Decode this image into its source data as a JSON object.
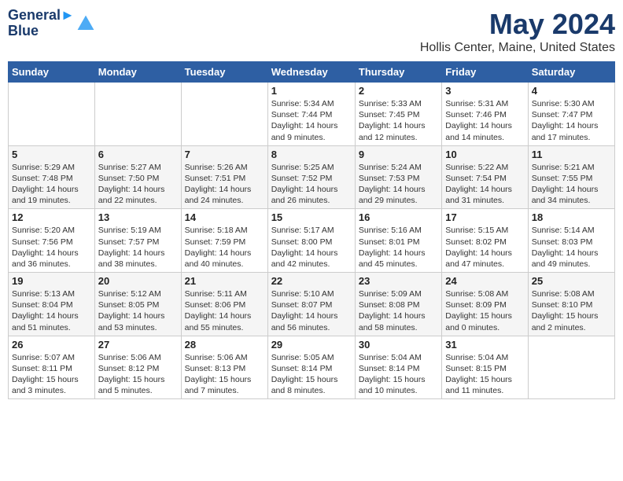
{
  "header": {
    "logo_line1": "General",
    "logo_line2": "Blue",
    "month": "May 2024",
    "location": "Hollis Center, Maine, United States"
  },
  "weekdays": [
    "Sunday",
    "Monday",
    "Tuesday",
    "Wednesday",
    "Thursday",
    "Friday",
    "Saturday"
  ],
  "weeks": [
    [
      {
        "day": "",
        "info": ""
      },
      {
        "day": "",
        "info": ""
      },
      {
        "day": "",
        "info": ""
      },
      {
        "day": "1",
        "info": "Sunrise: 5:34 AM\nSunset: 7:44 PM\nDaylight: 14 hours\nand 9 minutes."
      },
      {
        "day": "2",
        "info": "Sunrise: 5:33 AM\nSunset: 7:45 PM\nDaylight: 14 hours\nand 12 minutes."
      },
      {
        "day": "3",
        "info": "Sunrise: 5:31 AM\nSunset: 7:46 PM\nDaylight: 14 hours\nand 14 minutes."
      },
      {
        "day": "4",
        "info": "Sunrise: 5:30 AM\nSunset: 7:47 PM\nDaylight: 14 hours\nand 17 minutes."
      }
    ],
    [
      {
        "day": "5",
        "info": "Sunrise: 5:29 AM\nSunset: 7:48 PM\nDaylight: 14 hours\nand 19 minutes."
      },
      {
        "day": "6",
        "info": "Sunrise: 5:27 AM\nSunset: 7:50 PM\nDaylight: 14 hours\nand 22 minutes."
      },
      {
        "day": "7",
        "info": "Sunrise: 5:26 AM\nSunset: 7:51 PM\nDaylight: 14 hours\nand 24 minutes."
      },
      {
        "day": "8",
        "info": "Sunrise: 5:25 AM\nSunset: 7:52 PM\nDaylight: 14 hours\nand 26 minutes."
      },
      {
        "day": "9",
        "info": "Sunrise: 5:24 AM\nSunset: 7:53 PM\nDaylight: 14 hours\nand 29 minutes."
      },
      {
        "day": "10",
        "info": "Sunrise: 5:22 AM\nSunset: 7:54 PM\nDaylight: 14 hours\nand 31 minutes."
      },
      {
        "day": "11",
        "info": "Sunrise: 5:21 AM\nSunset: 7:55 PM\nDaylight: 14 hours\nand 34 minutes."
      }
    ],
    [
      {
        "day": "12",
        "info": "Sunrise: 5:20 AM\nSunset: 7:56 PM\nDaylight: 14 hours\nand 36 minutes."
      },
      {
        "day": "13",
        "info": "Sunrise: 5:19 AM\nSunset: 7:57 PM\nDaylight: 14 hours\nand 38 minutes."
      },
      {
        "day": "14",
        "info": "Sunrise: 5:18 AM\nSunset: 7:59 PM\nDaylight: 14 hours\nand 40 minutes."
      },
      {
        "day": "15",
        "info": "Sunrise: 5:17 AM\nSunset: 8:00 PM\nDaylight: 14 hours\nand 42 minutes."
      },
      {
        "day": "16",
        "info": "Sunrise: 5:16 AM\nSunset: 8:01 PM\nDaylight: 14 hours\nand 45 minutes."
      },
      {
        "day": "17",
        "info": "Sunrise: 5:15 AM\nSunset: 8:02 PM\nDaylight: 14 hours\nand 47 minutes."
      },
      {
        "day": "18",
        "info": "Sunrise: 5:14 AM\nSunset: 8:03 PM\nDaylight: 14 hours\nand 49 minutes."
      }
    ],
    [
      {
        "day": "19",
        "info": "Sunrise: 5:13 AM\nSunset: 8:04 PM\nDaylight: 14 hours\nand 51 minutes."
      },
      {
        "day": "20",
        "info": "Sunrise: 5:12 AM\nSunset: 8:05 PM\nDaylight: 14 hours\nand 53 minutes."
      },
      {
        "day": "21",
        "info": "Sunrise: 5:11 AM\nSunset: 8:06 PM\nDaylight: 14 hours\nand 55 minutes."
      },
      {
        "day": "22",
        "info": "Sunrise: 5:10 AM\nSunset: 8:07 PM\nDaylight: 14 hours\nand 56 minutes."
      },
      {
        "day": "23",
        "info": "Sunrise: 5:09 AM\nSunset: 8:08 PM\nDaylight: 14 hours\nand 58 minutes."
      },
      {
        "day": "24",
        "info": "Sunrise: 5:08 AM\nSunset: 8:09 PM\nDaylight: 15 hours\nand 0 minutes."
      },
      {
        "day": "25",
        "info": "Sunrise: 5:08 AM\nSunset: 8:10 PM\nDaylight: 15 hours\nand 2 minutes."
      }
    ],
    [
      {
        "day": "26",
        "info": "Sunrise: 5:07 AM\nSunset: 8:11 PM\nDaylight: 15 hours\nand 3 minutes."
      },
      {
        "day": "27",
        "info": "Sunrise: 5:06 AM\nSunset: 8:12 PM\nDaylight: 15 hours\nand 5 minutes."
      },
      {
        "day": "28",
        "info": "Sunrise: 5:06 AM\nSunset: 8:13 PM\nDaylight: 15 hours\nand 7 minutes."
      },
      {
        "day": "29",
        "info": "Sunrise: 5:05 AM\nSunset: 8:14 PM\nDaylight: 15 hours\nand 8 minutes."
      },
      {
        "day": "30",
        "info": "Sunrise: 5:04 AM\nSunset: 8:14 PM\nDaylight: 15 hours\nand 10 minutes."
      },
      {
        "day": "31",
        "info": "Sunrise: 5:04 AM\nSunset: 8:15 PM\nDaylight: 15 hours\nand 11 minutes."
      },
      {
        "day": "",
        "info": ""
      }
    ]
  ]
}
